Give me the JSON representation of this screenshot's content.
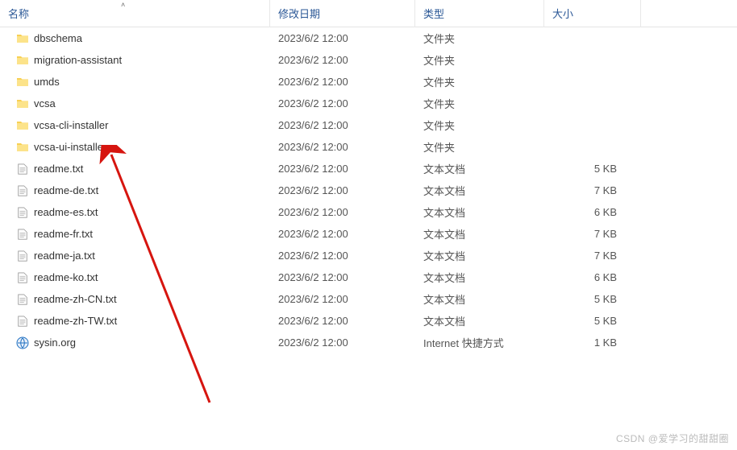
{
  "columns": {
    "name": "名称",
    "date": "修改日期",
    "type": "类型",
    "size": "大小"
  },
  "rows": [
    {
      "icon": "folder",
      "name": "dbschema",
      "date": "2023/6/2 12:00",
      "type": "文件夹",
      "size": ""
    },
    {
      "icon": "folder",
      "name": "migration-assistant",
      "date": "2023/6/2 12:00",
      "type": "文件夹",
      "size": ""
    },
    {
      "icon": "folder",
      "name": "umds",
      "date": "2023/6/2 12:00",
      "type": "文件夹",
      "size": ""
    },
    {
      "icon": "folder",
      "name": "vcsa",
      "date": "2023/6/2 12:00",
      "type": "文件夹",
      "size": ""
    },
    {
      "icon": "folder",
      "name": "vcsa-cli-installer",
      "date": "2023/6/2 12:00",
      "type": "文件夹",
      "size": ""
    },
    {
      "icon": "folder",
      "name": "vcsa-ui-installer",
      "date": "2023/6/2 12:00",
      "type": "文件夹",
      "size": ""
    },
    {
      "icon": "file",
      "name": "readme.txt",
      "date": "2023/6/2 12:00",
      "type": "文本文档",
      "size": "5 KB"
    },
    {
      "icon": "file",
      "name": "readme-de.txt",
      "date": "2023/6/2 12:00",
      "type": "文本文档",
      "size": "7 KB"
    },
    {
      "icon": "file",
      "name": "readme-es.txt",
      "date": "2023/6/2 12:00",
      "type": "文本文档",
      "size": "6 KB"
    },
    {
      "icon": "file",
      "name": "readme-fr.txt",
      "date": "2023/6/2 12:00",
      "type": "文本文档",
      "size": "7 KB"
    },
    {
      "icon": "file",
      "name": "readme-ja.txt",
      "date": "2023/6/2 12:00",
      "type": "文本文档",
      "size": "7 KB"
    },
    {
      "icon": "file",
      "name": "readme-ko.txt",
      "date": "2023/6/2 12:00",
      "type": "文本文档",
      "size": "6 KB"
    },
    {
      "icon": "file",
      "name": "readme-zh-CN.txt",
      "date": "2023/6/2 12:00",
      "type": "文本文档",
      "size": "5 KB"
    },
    {
      "icon": "file",
      "name": "readme-zh-TW.txt",
      "date": "2023/6/2 12:00",
      "type": "文本文档",
      "size": "5 KB"
    },
    {
      "icon": "link",
      "name": "sysin.org",
      "date": "2023/6/2 12:00",
      "type": "Internet 快捷方式",
      "size": "1 KB"
    }
  ],
  "watermark": "CSDN @爱学习的甜甜圈",
  "annotation": {
    "arrow_color": "#d6150f",
    "points_to": "vcsa-ui-installer"
  }
}
